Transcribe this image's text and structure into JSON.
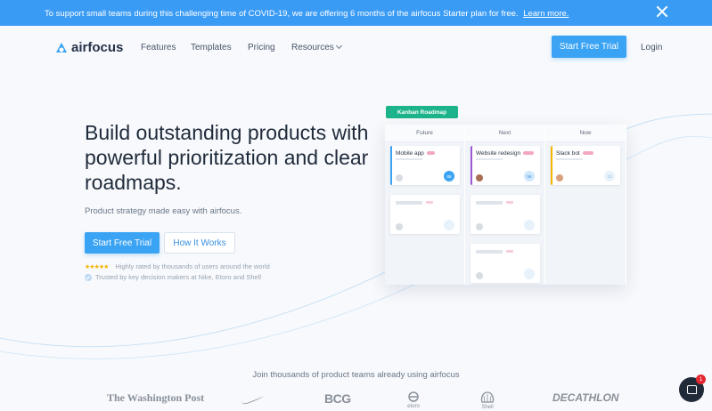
{
  "banner": {
    "text": "To support small teams during this challenging time of COVID-19, we are offering 6 months of the airfocus Starter plan for free.",
    "link": "Learn more."
  },
  "nav": {
    "brand": "airfocus",
    "links": [
      "Features",
      "Templates",
      "Pricing",
      "Resources"
    ],
    "cta": "Start Free Trial",
    "login": "Login"
  },
  "hero": {
    "title": "Build outstanding products with powerful prioritization and clear roadmaps.",
    "subtitle": "Product strategy made easy with airfocus.",
    "primary_cta": "Start Free Trial",
    "secondary_cta": "How It Works",
    "rating_text": "Highly rated by thousands of users around the world",
    "trust_text": "Trusted by key decision makers at Nike, Etoro and Shell",
    "stars": "★★★★★"
  },
  "kanban": {
    "tag": "Kanban Roadmap",
    "columns": [
      "Future",
      "Next",
      "Now"
    ],
    "cards": {
      "future": {
        "title": "Mobile app",
        "score": "88",
        "color": "#3aa3f4"
      },
      "next": {
        "title": "Website redesign",
        "score": "56",
        "color": "#9b59d6"
      },
      "now": {
        "title": "Slack bot",
        "score": "12",
        "color": "#f5b400"
      }
    }
  },
  "social": {
    "join_text": "Join thousands of product teams already using airfocus",
    "logos": [
      "The Washington Post",
      "BCG",
      "etoro",
      "Shell",
      "DECATHLON"
    ]
  },
  "chat": {
    "badge": "1"
  },
  "colors": {
    "primary": "#3aa3f4",
    "banner": "#3a9bf5",
    "kanban_tag": "#1db38b"
  }
}
